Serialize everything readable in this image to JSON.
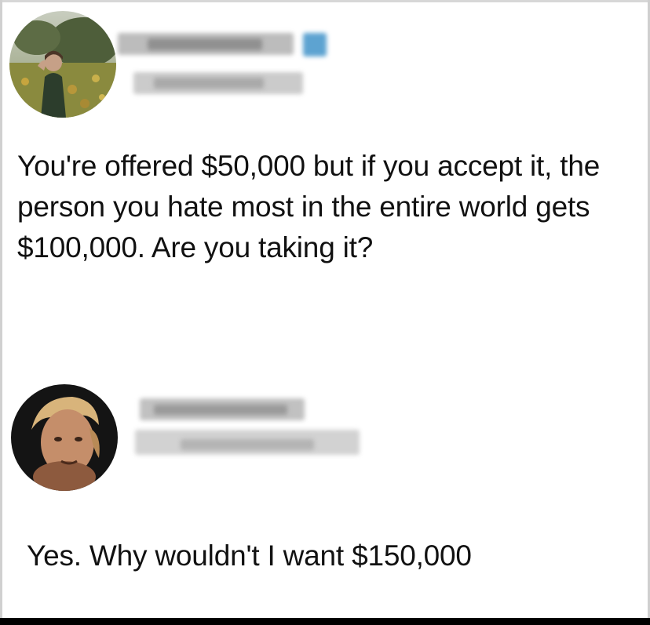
{
  "post": {
    "text": "You're offered $50,000 but if you accept it, the person you hate most in the entire world gets $100,000. Are you taking it?"
  },
  "reply": {
    "text": "Yes. Why wouldn't I want $150,000"
  },
  "colors": {
    "text": "#111111",
    "background": "#ffffff",
    "verified_badge": "#5da3d1",
    "redaction": "#b8b8b8"
  },
  "icons": {
    "poster_avatar": "person-in-field-photo",
    "replier_avatar": "man-face-photo",
    "badge": "verified-icon"
  }
}
